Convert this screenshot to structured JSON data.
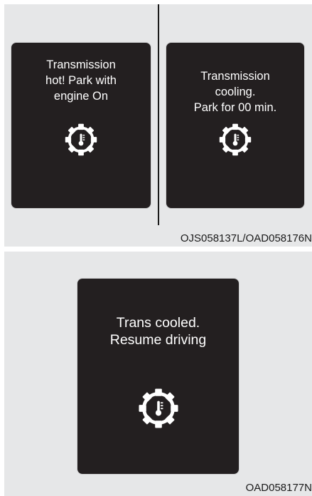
{
  "warnings": [
    {
      "message": "Transmission\nhot! Park with\nengine On",
      "icon": "transmission-temperature-icon"
    },
    {
      "message": "Transmission\ncooling.\nPark for 00 min.",
      "icon": "transmission-temperature-icon"
    },
    {
      "message": "Trans cooled.\nResume driving",
      "icon": "transmission-temperature-icon"
    }
  ],
  "captions": {
    "top": "OJS058137L/OAD058176N",
    "bottom": "OAD058177N"
  },
  "colors": {
    "background": "#e6e7e8",
    "screen": "#231f20",
    "text": "#ffffff"
  }
}
